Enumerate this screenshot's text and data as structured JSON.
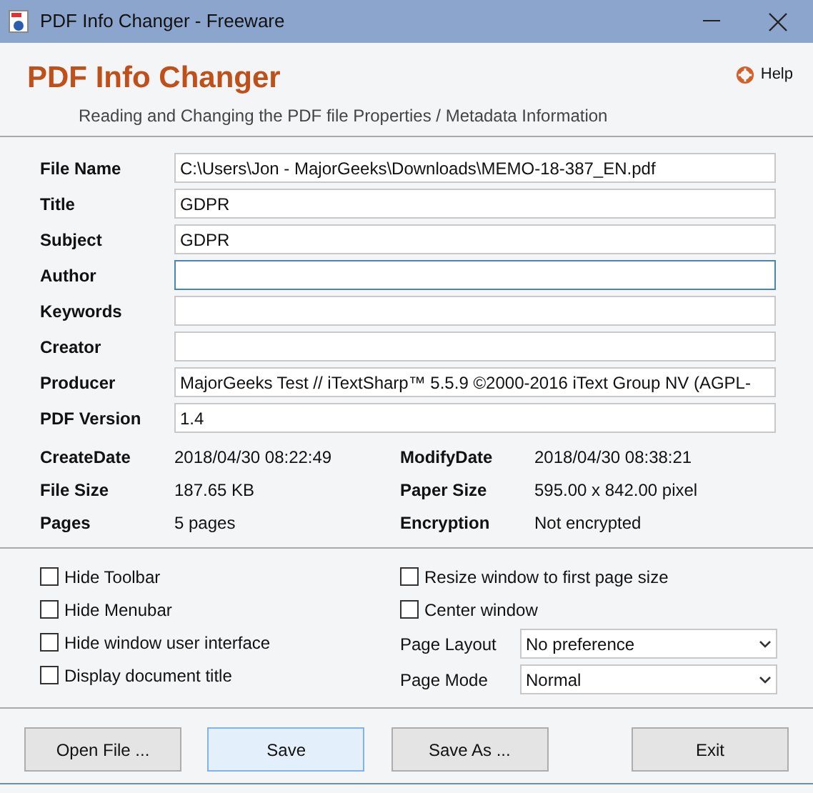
{
  "window": {
    "title": "PDF Info Changer - Freeware"
  },
  "header": {
    "title": "PDF Info Changer",
    "subtitle": "Reading and Changing the PDF file Properties / Metadata Information",
    "help": "Help"
  },
  "fields": [
    {
      "label": "File Name",
      "value": "C:\\Users\\Jon - MajorGeeks\\Downloads\\MEMO-18-387_EN.pdf",
      "focused": false
    },
    {
      "label": "Title",
      "value": "GDPR",
      "focused": false
    },
    {
      "label": "Subject",
      "value": "GDPR",
      "focused": false
    },
    {
      "label": "Author",
      "focused": true
    },
    {
      "label": "Keywords",
      "focused": false
    },
    {
      "label": "Creator",
      "focused": false
    },
    {
      "label": "Producer",
      "value": "MajorGeeks Test // iTextSharp™ 5.5.9 ©2000-2016 iText Group NV (AGPL-",
      "focused": false
    },
    {
      "label": "PDF Version",
      "value": "1.4",
      "focused": false
    }
  ],
  "info": [
    {
      "label": "CreateDate",
      "value": "2018/04/30 08:22:49"
    },
    {
      "label": "ModifyDate",
      "value": "2018/04/30 08:38:21"
    },
    {
      "label": "File Size",
      "value": "187.65 KB"
    },
    {
      "label": "Paper Size",
      "value": "595.00 x 842.00 pixel"
    },
    {
      "label": "Pages",
      "value": "5 pages"
    },
    {
      "label": "Encryption",
      "value": "Not encrypted"
    }
  ],
  "options_left": [
    {
      "label": "Hide Toolbar",
      "checked": false
    },
    {
      "label": "Hide Menubar",
      "checked": false
    },
    {
      "label": "Hide window user interface",
      "checked": false
    },
    {
      "label": "Display document title",
      "checked": false
    }
  ],
  "options_right": [
    {
      "kind": "checkbox",
      "label": "Resize window to first page size",
      "checked": false
    },
    {
      "kind": "checkbox",
      "label": "Center window",
      "checked": false
    },
    {
      "kind": "dropdown",
      "label": "Page Layout",
      "value": "No preference"
    },
    {
      "kind": "dropdown",
      "label": "Page Mode",
      "value": "Normal"
    }
  ],
  "buttons": [
    {
      "label": "Open File ...",
      "selected": false
    },
    {
      "label": "Save",
      "selected": true
    },
    {
      "label": "Save As ...",
      "selected": false
    },
    {
      "label": "Exit",
      "selected": false
    }
  ]
}
